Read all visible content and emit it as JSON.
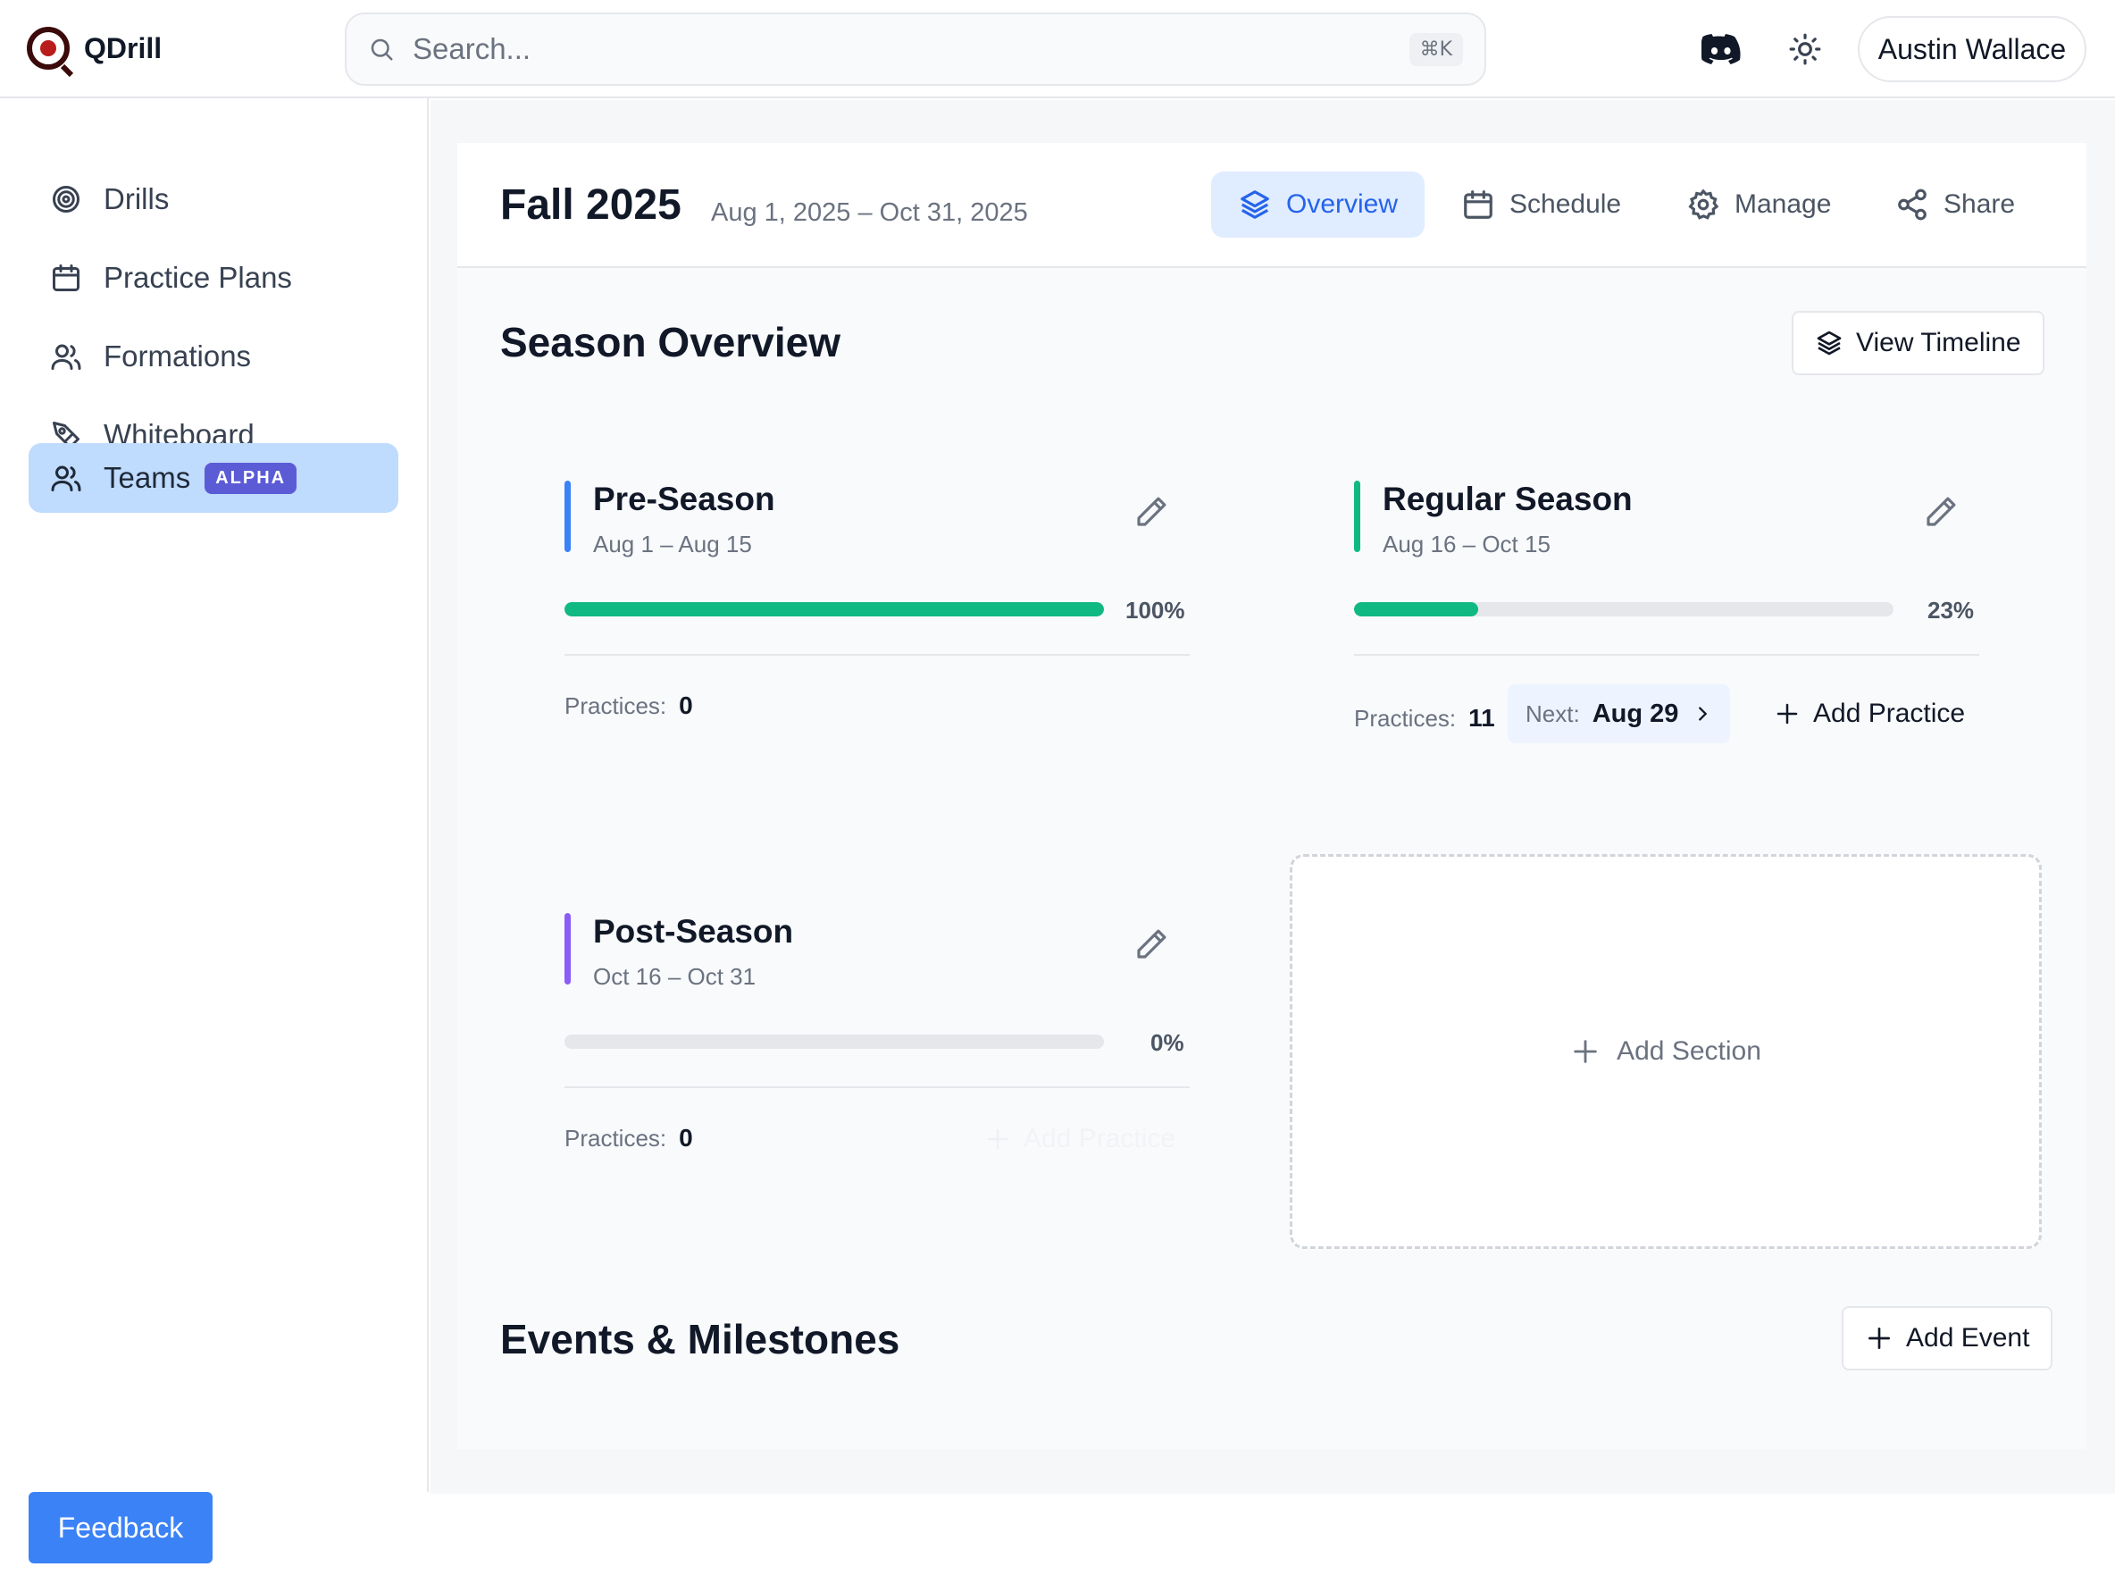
{
  "app": {
    "name": "QDrill"
  },
  "search": {
    "placeholder": "Search...",
    "shortcut": "⌘K"
  },
  "header": {
    "user_name": "Austin Wallace"
  },
  "sidebar": {
    "items": [
      {
        "label": "Drills",
        "icon": "target-icon"
      },
      {
        "label": "Practice Plans",
        "icon": "calendar-icon"
      },
      {
        "label": "Formations",
        "icon": "users-icon"
      },
      {
        "label": "Whiteboard",
        "icon": "pen-tool-icon"
      },
      {
        "label": "Teams",
        "icon": "users-icon",
        "badge": "ALPHA",
        "active": true
      }
    ],
    "feedback_label": "Feedback"
  },
  "season": {
    "title": "Fall 2025",
    "dates": "Aug 1, 2025 – Oct 31, 2025",
    "tabs": [
      {
        "label": "Overview",
        "active": true
      },
      {
        "label": "Schedule"
      },
      {
        "label": "Manage"
      },
      {
        "label": "Share"
      }
    ]
  },
  "overview": {
    "title": "Season Overview",
    "view_timeline_label": "View Timeline",
    "phases": [
      {
        "name": "Pre-Season",
        "range": "Aug 1 – Aug 15",
        "color": "#3b82f6",
        "progress": 1.0,
        "progress_label": "100%",
        "practices_label": "Practices:",
        "practices": "0"
      },
      {
        "name": "Regular Season",
        "range": "Aug 16 – Oct 15",
        "color": "#10b981",
        "progress": 0.23,
        "progress_label": "23%",
        "practices_label": "Practices:",
        "practices": "11",
        "next_label": "Next:",
        "next_date": "Aug 29",
        "add_practice_label": "Add Practice"
      },
      {
        "name": "Post-Season",
        "range": "Oct 16 – Oct 31",
        "color": "#8b5cf6",
        "progress": 0.0,
        "progress_label": "0%",
        "practices_label": "Practices:",
        "practices": "0",
        "add_practice_label": "Add Practice"
      }
    ],
    "add_section_label": "Add Section"
  },
  "events": {
    "title": "Events & Milestones",
    "add_event_label": "Add Event"
  },
  "colors": {
    "accent": "#2563eb",
    "active_nav": "#bfdbfe",
    "badge": "#5b5bd6",
    "feedback": "#3b82f6"
  }
}
